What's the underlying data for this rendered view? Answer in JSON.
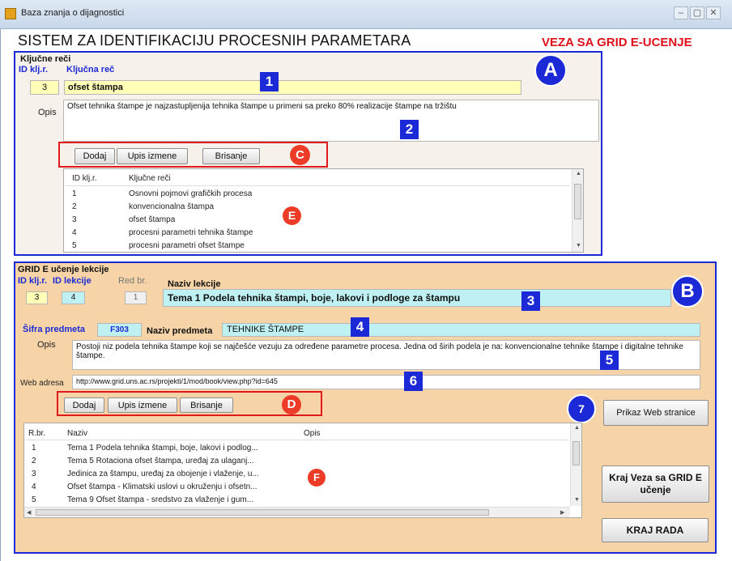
{
  "window": {
    "title": "Baza znanja o dijagnostici",
    "controls": [
      "–",
      "▢",
      "✕"
    ]
  },
  "header": {
    "title": "SISTEM ZA IDENTIFIKACIJU PROCESNIH PARAMETARA",
    "link": "VEZA SA GRID E-UCENJE"
  },
  "keywords": {
    "group_label": "Ključne reči",
    "id_label": "ID klj.r.",
    "keyword_label": "Ključna reč",
    "id_value": "3",
    "keyword_value": "ofset štampa",
    "desc_label": "Opis",
    "desc_value": "Ofset tehnika štampe je najzastupljenija tehnika štampe u primeni sa preko 80% realizacije štampe na tržištu",
    "buttons": {
      "add": "Dodaj",
      "update": "Upis izmene",
      "delete": "Brisanje"
    },
    "list": {
      "columns": [
        "ID klj.r.",
        "Ključne reči"
      ],
      "rows": [
        [
          "1",
          "Osnovni pojmovi grafičkih procesa"
        ],
        [
          "2",
          "konvencionalna štampa"
        ],
        [
          "3",
          "ofset štampa"
        ],
        [
          "4",
          "procesni parametri tehnika štampe"
        ],
        [
          "5",
          "procesni parametri ofset  štampe"
        ]
      ]
    }
  },
  "lessons": {
    "group_label": "GRID E učenje lekcije",
    "id_kr_label": "ID klj.r.",
    "id_lesson_label": "ID lekcije",
    "ord_label": "Red br.",
    "name_label": "Naziv lekcije",
    "id_kr_value": "3",
    "id_lesson_value": "4",
    "ord_value": "1",
    "name_value": "Tema 1 Podela tehnika štampi, boje, lakovi i podloge za štampu",
    "subject_code_label": "Šifra predmeta",
    "subject_code_value": "F303",
    "subject_name_label": "Naziv predmeta",
    "subject_name_value": "TEHNIKE ŠTAMPE",
    "desc_label": "Opis",
    "desc_value": "Postoji niz podela tehnika štampe koji se najčešće vezuju za određene parametre procesa. Jedna od širih podela je na: konvencionalne tehnike štampe i digitalne tehnike štampe.",
    "web_label": "Web adresa",
    "web_value": "http://www.grid.uns.ac.rs/projekti/1/mod/book/view.php?id=645",
    "buttons": {
      "add": "Dodaj",
      "update": "Upis izmene",
      "delete": "Brisanje"
    },
    "list": {
      "columns": [
        "R.br.",
        "Naziv",
        "Opis"
      ],
      "rows": [
        [
          "1",
          "Tema 1 Podela tehnika štampi, boje, lakovi i podlog..."
        ],
        [
          "2",
          "Tema 5 Rotaciona ofset štampa, uređaj za ulaganj..."
        ],
        [
          "3",
          "Jedinica za štampu, uređaj za obojenje i vlaženje, u..."
        ],
        [
          "4",
          "Ofset štampa - Klimatski uslovi u okruženju i ofsetn..."
        ],
        [
          "5",
          "Tema 9 Ofset štampa - sredstvo za vlaženje i gum..."
        ]
      ]
    },
    "btn_web": "Prikaz Web stranice",
    "btn_end_link": "Kraj Veza sa GRID E učenje",
    "btn_end": "KRAJ RADA"
  },
  "markers": {
    "A": "A",
    "B": "B",
    "C": "C",
    "D": "D",
    "E": "E",
    "F": "F",
    "n1": "1",
    "n2": "2",
    "n3": "3",
    "n4": "4",
    "n5": "5",
    "n6": "6",
    "n7": "7"
  },
  "colors": {
    "panel_border": "#1b2ad6",
    "panel_b_bg": "#f7d4a7",
    "marker_red": "#ec3b26",
    "highlight_yellow": "#ffffb8",
    "highlight_cyan": "#bff0f2"
  }
}
